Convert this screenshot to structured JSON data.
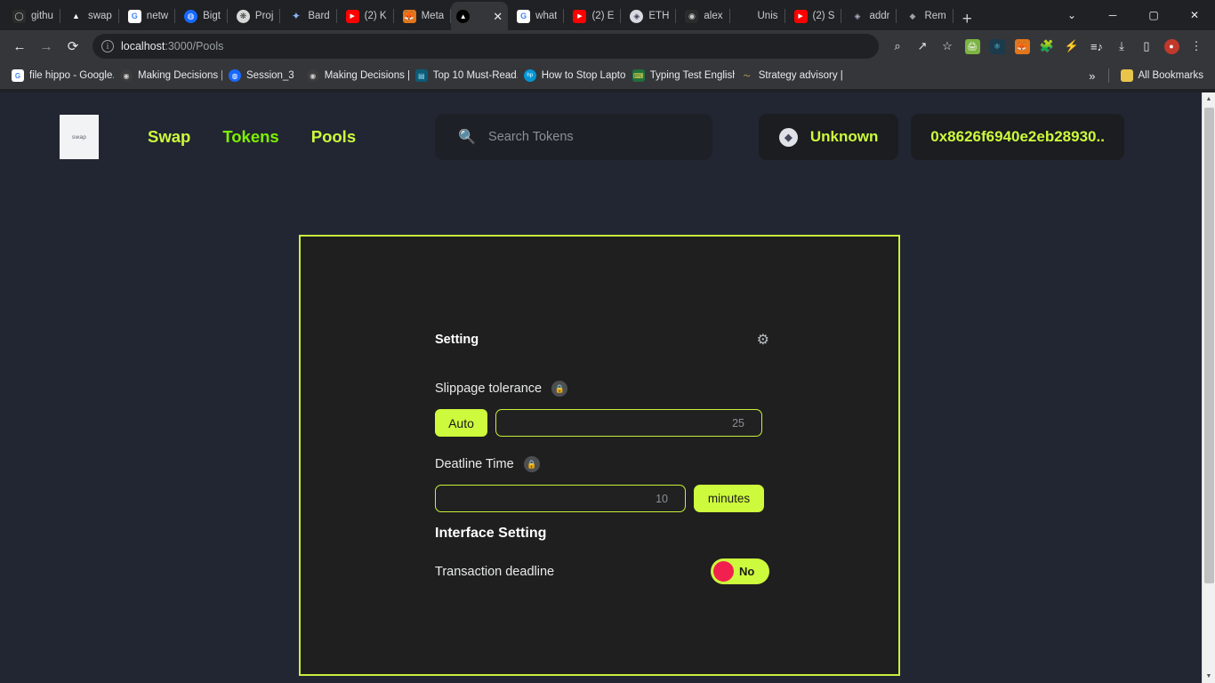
{
  "browser": {
    "tabs": [
      {
        "label": "githu",
        "icon": "github-icon",
        "icon_glyph": "◯",
        "icon_bg": "#2b2b2b",
        "icon_fg": "#c8ccd0",
        "active": false
      },
      {
        "label": "swap",
        "icon": "nextjs-icon",
        "icon_glyph": "▲",
        "icon_bg": "#202124",
        "icon_fg": "#ffffff",
        "active": false
      },
      {
        "label": "netw",
        "icon": "google-icon",
        "icon_glyph": "G",
        "icon_bg": "#ffffff",
        "icon_fg": "#4285f4",
        "active": false
      },
      {
        "label": "Bigt",
        "icon": "globe-icon",
        "icon_glyph": "◍",
        "icon_bg": "#1769ff",
        "icon_fg": "#ffffff",
        "active": false
      },
      {
        "label": "Proj",
        "icon": "openai-icon",
        "icon_glyph": "❋",
        "icon_bg": "#d7d7d7",
        "icon_fg": "#3c3c3c",
        "active": false
      },
      {
        "label": "Bard",
        "icon": "bard-icon",
        "icon_glyph": "✦",
        "icon_bg": "#202124",
        "icon_fg": "#8ab4f8",
        "active": false
      },
      {
        "label": "(2) K",
        "icon": "youtube-icon",
        "icon_glyph": "▶",
        "icon_bg": "#ff0000",
        "icon_fg": "#ffffff",
        "active": false
      },
      {
        "label": "Meta",
        "icon": "metamask-icon",
        "icon_glyph": "🦊",
        "icon_bg": "#e2761b",
        "icon_fg": "#ffffff",
        "active": false
      },
      {
        "label": "",
        "icon": "nextjs-icon",
        "icon_glyph": "▲",
        "icon_bg": "#202124",
        "icon_fg": "#ffffff",
        "active": true,
        "close": "✕"
      },
      {
        "label": "what",
        "icon": "google-icon",
        "icon_glyph": "G",
        "icon_bg": "#ffffff",
        "icon_fg": "#4285f4",
        "active": false
      },
      {
        "label": "(2) E",
        "icon": "youtube-icon",
        "icon_glyph": "▶",
        "icon_bg": "#ff0000",
        "icon_fg": "#ffffff",
        "active": false
      },
      {
        "label": "ETH",
        "icon": "ethereum-icon",
        "icon_glyph": "◈",
        "icon_bg": "#d9d9e3",
        "icon_fg": "#3c3c53",
        "active": false
      },
      {
        "label": "alex",
        "icon": "github-icon",
        "icon_glyph": "◉",
        "icon_bg": "#2b2b2b",
        "icon_fg": "#c8ccd0",
        "active": false
      },
      {
        "label": "Unis",
        "icon": "blank-icon",
        "icon_glyph": "",
        "icon_bg": "#202124",
        "icon_fg": "#c8ccd0",
        "active": false
      },
      {
        "label": "(2) S",
        "icon": "youtube-icon",
        "icon_glyph": "▶",
        "icon_bg": "#ff0000",
        "icon_fg": "#ffffff",
        "active": false
      },
      {
        "label": "addr",
        "icon": "etherscan-icon",
        "icon_glyph": "◈",
        "icon_bg": "#202124",
        "icon_fg": "#aab0c6",
        "active": false
      },
      {
        "label": "Rem",
        "icon": "remix-icon",
        "icon_glyph": "◆",
        "icon_bg": "#202124",
        "icon_fg": "#9aa0a6",
        "active": false
      }
    ],
    "new_tab_label": "+",
    "window_controls": {
      "chevron": "⌄",
      "minimize": "─",
      "maximize": "▢",
      "close": "✕"
    },
    "toolbar": {
      "back": "←",
      "forward": "→",
      "reload": "⟳",
      "info_icon": "i",
      "url_host": "localhost",
      "url_path": ":3000/Pools",
      "zoom_out_icon": "⌕",
      "share_icon": "↗",
      "bookmark_star": "☆",
      "extensions": [
        {
          "name": "printer-extension-icon",
          "glyph": "🖨",
          "bg": "#7cb342"
        },
        {
          "name": "react-devtools-icon",
          "glyph": "⚛",
          "bg": "#1b3a4b"
        },
        {
          "name": "metamask-extension-icon",
          "glyph": "🦊",
          "bg": "#e2761b"
        },
        {
          "name": "puzzle-extensions-icon",
          "glyph": "🧩",
          "bg": "#35363a"
        },
        {
          "name": "lightning-extension-icon",
          "glyph": "⚡",
          "bg": "#35363a"
        },
        {
          "name": "reading-list-icon",
          "glyph": "♫",
          "bg": "#35363a"
        },
        {
          "name": "downloads-icon",
          "glyph": "⤓",
          "bg": "#35363a"
        },
        {
          "name": "sidepanel-icon",
          "glyph": "▯",
          "bg": "#35363a"
        },
        {
          "name": "profile-avatar",
          "glyph": "●",
          "bg": "#c0392b"
        },
        {
          "name": "chrome-menu-icon",
          "glyph": "⋮",
          "bg": "#35363a"
        }
      ]
    },
    "bookmarks": {
      "items": [
        {
          "label": "file hippo - Google...",
          "icon": "google-icon",
          "glyph": "G",
          "bg": "#ffffff",
          "fg": "#4285f4"
        },
        {
          "label": "Making Decisions |...",
          "icon": "coursera-icon",
          "glyph": "◉",
          "bg": "#3c3c3c",
          "fg": "#d0d0d0"
        },
        {
          "label": "Session_3",
          "icon": "globe-icon",
          "glyph": "◍",
          "bg": "#1769ff",
          "fg": "#ffffff"
        },
        {
          "label": "Making Decisions |...",
          "icon": "coursera-icon",
          "glyph": "◉",
          "bg": "#3c3c3c",
          "fg": "#d0d0d0"
        },
        {
          "label": "Top 10 Must-Read...",
          "icon": "article-icon",
          "glyph": "▤",
          "bg": "#0d5b77",
          "fg": "#9adcf0"
        },
        {
          "label": "How to Stop Lapto...",
          "icon": "hp-icon",
          "glyph": "hp",
          "bg": "#0096d6",
          "fg": "#ffffff"
        },
        {
          "label": "Typing Test English...",
          "icon": "typing-icon",
          "glyph": "⌨",
          "bg": "#1f6f3c",
          "fg": "#e8d44d"
        },
        {
          "label": "Strategy advisory |...",
          "icon": "strategy-icon",
          "glyph": "〜",
          "bg": "#222633",
          "fg": "#d6c24a"
        }
      ],
      "overflow_label": "»",
      "all_bookmarks_label": "All Bookmarks",
      "all_bookmarks_icon": "folder-icon",
      "all_bookmarks_glyph": "▮"
    },
    "scrollbar": {
      "up_arrow": "▲",
      "down_arrow": "▼"
    }
  },
  "app": {
    "logo_text": "swap",
    "nav": [
      {
        "label": "Swap",
        "active": false
      },
      {
        "label": "Tokens",
        "active": true
      },
      {
        "label": "Pools",
        "active": false
      }
    ],
    "search": {
      "icon": "search-icon",
      "icon_glyph": "🔍",
      "placeholder": "Search Tokens",
      "value": ""
    },
    "network_chip": {
      "icon": "ethereum-icon",
      "icon_glyph": "◆",
      "label": "Unknown"
    },
    "wallet_chip": {
      "address": "0x8626f6940e2eb28930.."
    },
    "colors": {
      "accent": "#cdfa3c",
      "nav_active": "#7ef000",
      "page_bg": "#222633",
      "card_bg": "#1f1f1f",
      "toggle_knob": "#f2204e"
    }
  },
  "settings_card": {
    "title": "Setting",
    "gear_icon": "gear-icon",
    "gear_glyph": "⚙",
    "slippage": {
      "label": "Slippage tolerance",
      "info_icon": "lock-icon",
      "info_glyph": "🔒",
      "auto_button": "Auto",
      "input_value": "",
      "input_placeholder": "25"
    },
    "deadline": {
      "label": "Deatline Time",
      "info_icon": "lock-icon",
      "info_glyph": "🔒",
      "input_value": "",
      "input_placeholder": "10",
      "unit_button": "minutes"
    },
    "interface_section_title": "Interface Setting",
    "transaction_deadline": {
      "label": "Transaction deadline",
      "toggle_value": "No",
      "toggle_on": false
    }
  }
}
